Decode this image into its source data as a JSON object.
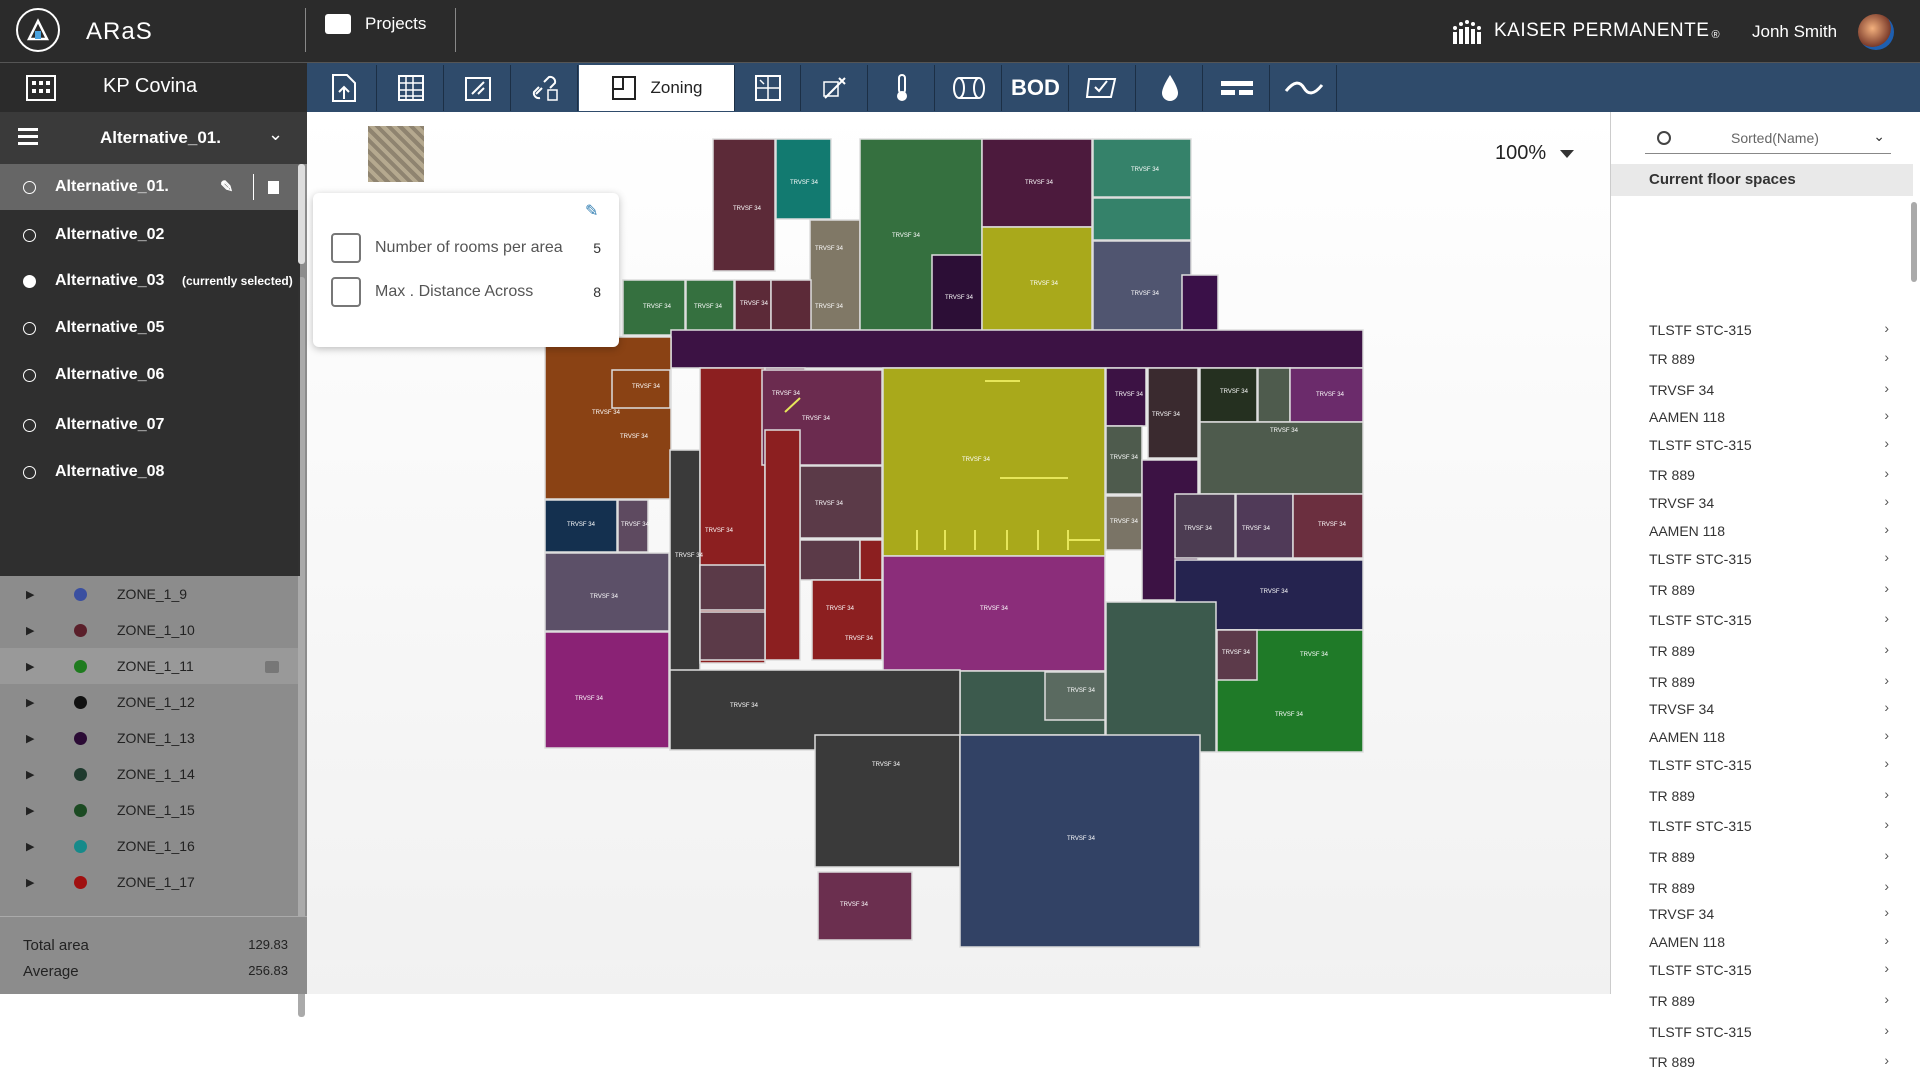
{
  "header": {
    "app_name": "ARaS",
    "projects_label": "Projects",
    "brand": "KAISER PERMANENTE",
    "brand_mark": "®",
    "user_name": "Jonh Smith"
  },
  "project": {
    "name": "KP Covina"
  },
  "toolbar": {
    "active_tool_label": "Zoning",
    "bod_label": "BOD"
  },
  "alternatives": {
    "selected_title": "Alternative_01.",
    "items": [
      {
        "label": "Alternative_01."
      },
      {
        "label": "Alternative_02"
      },
      {
        "label": "Alternative_03",
        "note": "(currently selected)"
      },
      {
        "label": "Alternative_05"
      },
      {
        "label": "Alternative_06"
      },
      {
        "label": "Alternative_07"
      },
      {
        "label": "Alternative_08"
      }
    ]
  },
  "zones": [
    {
      "label": "ZONE_1_9",
      "color": "#3a4fa0"
    },
    {
      "label": "ZONE_1_10",
      "color": "#5a1f2a"
    },
    {
      "label": "ZONE_1_11",
      "color": "#1e7b1e"
    },
    {
      "label": "ZONE_1_12",
      "color": "#111111"
    },
    {
      "label": "ZONE_1_13",
      "color": "#2b0b35"
    },
    {
      "label": "ZONE_1_14",
      "color": "#1f3a2e"
    },
    {
      "label": "ZONE_1_15",
      "color": "#1b4a22"
    },
    {
      "label": "ZONE_1_16",
      "color": "#168a8a"
    },
    {
      "label": "ZONE_1_17",
      "color": "#a01010"
    }
  ],
  "totals": {
    "total_area_label": "Total area",
    "total_area_value": "129.83",
    "average_label": "Average",
    "average_value": "256.83"
  },
  "canvas": {
    "zoom": "100%"
  },
  "popup": {
    "rooms_label": "Number of rooms per area",
    "rooms_value": "5",
    "distance_label": "Max . Distance Across",
    "distance_value": "8"
  },
  "right_panel": {
    "sort_label": "Sorted(Name)",
    "section_title": "Current floor spaces",
    "spaces": [
      "TLSTF STC-315",
      "TR 889",
      "TRVSF 34",
      "AAMEN 118",
      "TLSTF STC-315",
      "TR 889",
      "TRVSF 34",
      "AAMEN 118",
      "TLSTF STC-315",
      "TR 889",
      "TLSTF STC-315",
      "TR 889",
      "TR 889",
      "TRVSF 34",
      "AAMEN 118",
      "TLSTF STC-315",
      "TR 889",
      "TLSTF STC-315",
      "TR 889",
      "TR 889",
      "TRVSF 34",
      "AAMEN 118",
      "TLSTF STC-315",
      "TR 889",
      "TLSTF STC-315",
      "TR 889"
    ]
  }
}
